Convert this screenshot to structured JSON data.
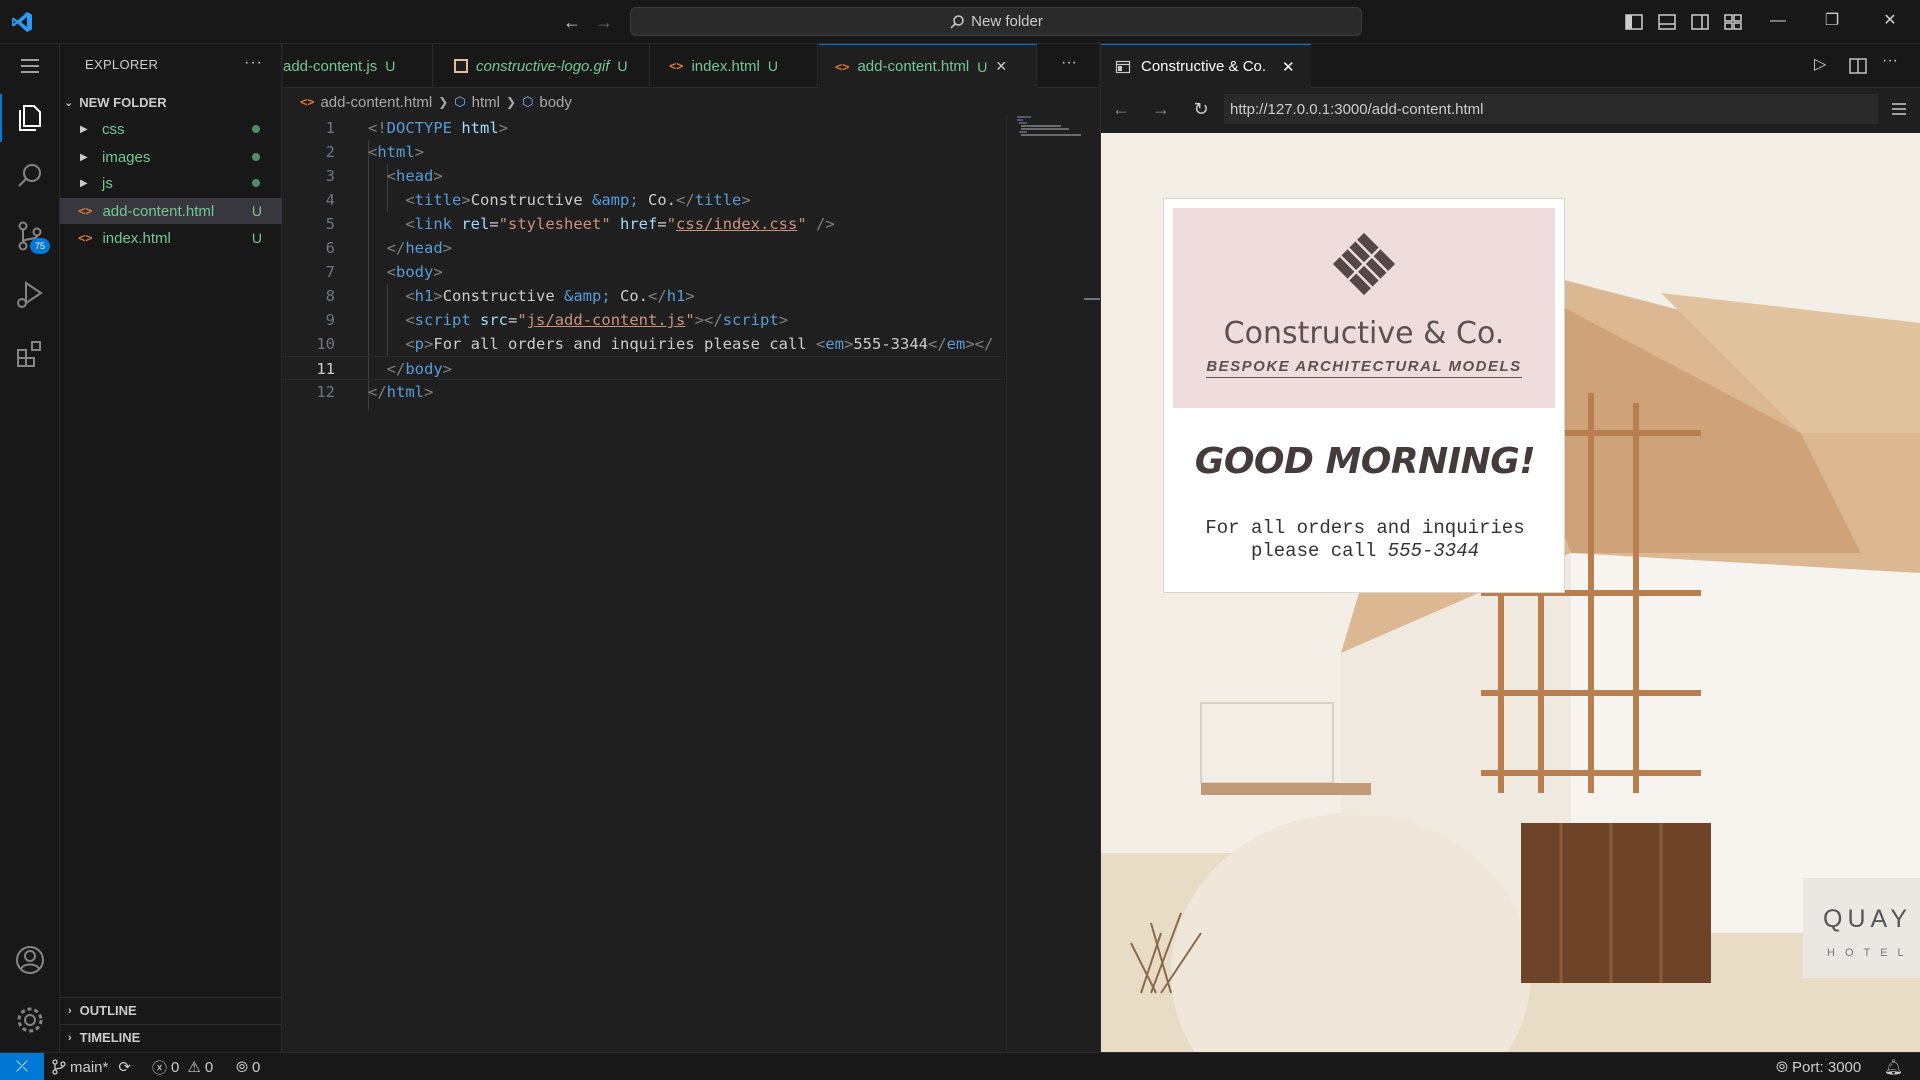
{
  "titlebar": {
    "search_text": "New folder"
  },
  "activity": {
    "scm_badge": "75"
  },
  "sidebar": {
    "title": "EXPLORER",
    "more": "···",
    "folder": "NEW FOLDER",
    "items": [
      {
        "label": "css",
        "type": "folder"
      },
      {
        "label": "images",
        "type": "folder"
      },
      {
        "label": "js",
        "type": "folder"
      },
      {
        "label": "add-content.html",
        "type": "file",
        "flag": "U"
      },
      {
        "label": "index.html",
        "type": "file",
        "flag": "U"
      }
    ],
    "outline": "OUTLINE",
    "timeline": "TIMELINE"
  },
  "tabs": [
    {
      "label": "add-content.js",
      "flag": "U"
    },
    {
      "label": "constructive-logo.gif",
      "flag": "U"
    },
    {
      "label": "index.html",
      "flag": "U"
    },
    {
      "label": "add-content.html",
      "flag": "U"
    }
  ],
  "tabs_more": "···",
  "breadcrumb": {
    "file": "add-content.html",
    "node1": "html",
    "node2": "body"
  },
  "code": {
    "line_numbers": [
      "1",
      "2",
      "3",
      "4",
      "5",
      "6",
      "7",
      "8",
      "9",
      "10",
      "11",
      "12"
    ],
    "current_line": 11
  },
  "preview": {
    "tab_label": "Constructive & Co.",
    "url": "http://127.0.0.1:3000/add-content.html",
    "page": {
      "logo_title": "Constructive & Co.",
      "logo_subtitle": "BESPOKE ARCHITECTURAL MODELS",
      "greeting": "GOOD MORNING!",
      "info_line1": "For all orders and inquiries",
      "info_line2_prefix": "please call ",
      "phone": "555-3344",
      "sign_title": "QUAY",
      "sign_sub": "HOTEL"
    }
  },
  "statusbar": {
    "branch": "main*",
    "errors": "0",
    "warnings": "0",
    "ports": "0",
    "port_label": "Port: 3000"
  },
  "colors": {
    "accent": "#0078d4",
    "untracked": "#73c991",
    "logo_bg": "#efdcdc"
  }
}
